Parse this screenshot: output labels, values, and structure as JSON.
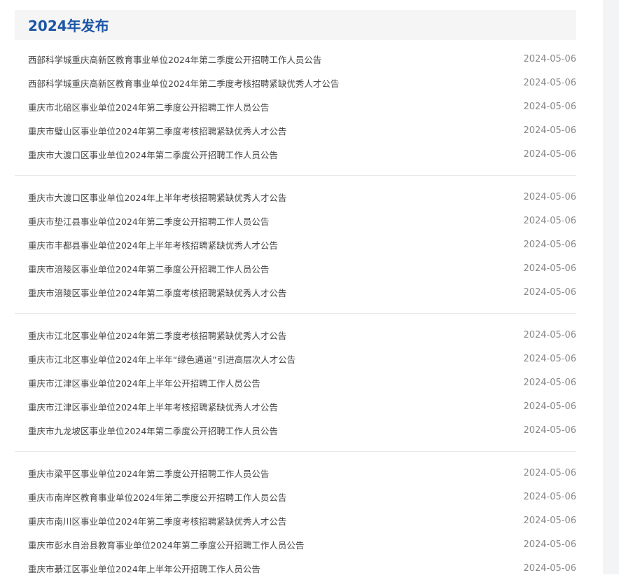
{
  "section": {
    "title": "2024年发布"
  },
  "groups": [
    {
      "items": [
        {
          "title": "西部科学城重庆高新区教育事业单位2024年第二季度公开招聘工作人员公告",
          "date": "2024-05-06"
        },
        {
          "title": "西部科学城重庆高新区教育事业单位2024年第二季度考核招聘紧缺优秀人才公告",
          "date": "2024-05-06"
        },
        {
          "title": "重庆市北碚区事业单位2024年第二季度公开招聘工作人员公告",
          "date": "2024-05-06"
        },
        {
          "title": "重庆市璧山区事业单位2024年第二季度考核招聘紧缺优秀人才公告",
          "date": "2024-05-06"
        },
        {
          "title": "重庆市大渡口区事业单位2024年第二季度公开招聘工作人员公告",
          "date": "2024-05-06"
        }
      ]
    },
    {
      "items": [
        {
          "title": "重庆市大渡口区事业单位2024年上半年考核招聘紧缺优秀人才公告",
          "date": "2024-05-06"
        },
        {
          "title": "重庆市垫江县事业单位2024年第二季度公开招聘工作人员公告",
          "date": "2024-05-06"
        },
        {
          "title": "重庆市丰都县事业单位2024年上半年考核招聘紧缺优秀人才公告",
          "date": "2024-05-06"
        },
        {
          "title": "重庆市涪陵区事业单位2024年第二季度公开招聘工作人员公告",
          "date": "2024-05-06"
        },
        {
          "title": "重庆市涪陵区事业单位2024年第二季度考核招聘紧缺优秀人才公告",
          "date": "2024-05-06"
        }
      ]
    },
    {
      "items": [
        {
          "title": "重庆市江北区事业单位2024年第二季度考核招聘紧缺优秀人才公告",
          "date": "2024-05-06"
        },
        {
          "title": "重庆市江北区事业单位2024年上半年“绿色通道”引进高层次人才公告",
          "date": "2024-05-06"
        },
        {
          "title": "重庆市江津区事业单位2024年上半年公开招聘工作人员公告",
          "date": "2024-05-06"
        },
        {
          "title": "重庆市江津区事业单位2024年上半年考核招聘紧缺优秀人才公告",
          "date": "2024-05-06"
        },
        {
          "title": "重庆市九龙坡区事业单位2024年第二季度公开招聘工作人员公告",
          "date": "2024-05-06"
        }
      ]
    },
    {
      "items": [
        {
          "title": "重庆市梁平区事业单位2024年第二季度公开招聘工作人员公告",
          "date": "2024-05-06"
        },
        {
          "title": "重庆市南岸区教育事业单位2024年第二季度公开招聘工作人员公告",
          "date": "2024-05-06"
        },
        {
          "title": "重庆市南川区事业单位2024年第二季度考核招聘紧缺优秀人才公告",
          "date": "2024-05-06"
        },
        {
          "title": "重庆市彭水自治县教育事业单位2024年第二季度公开招聘工作人员公告",
          "date": "2024-05-06"
        },
        {
          "title": "重庆市綦江区事业单位2024年上半年公开招聘工作人员公告",
          "date": "2024-05-06"
        }
      ]
    }
  ]
}
